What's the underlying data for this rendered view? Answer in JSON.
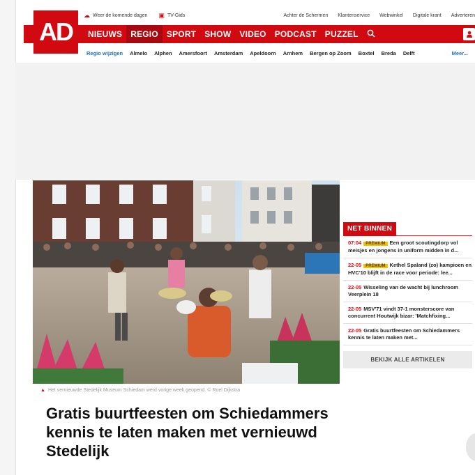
{
  "topbar": {
    "weather": "Weer de komende dagen",
    "tv": "TV-Gids",
    "links": [
      "Achter de Schermen",
      "Klantenservice",
      "Webwinkel",
      "Digitale krant",
      "Adverteren"
    ]
  },
  "logo": "AD",
  "nav": {
    "items": [
      "NIEUWS",
      "REGIO",
      "SPORT",
      "SHOW",
      "VIDEO",
      "PODCAST",
      "PUZZEL"
    ],
    "active": "REGIO"
  },
  "regio": {
    "change": "Regio wijzigen",
    "places": [
      "Almelo",
      "Alphen",
      "Amersfoort",
      "Amsterdam",
      "Apeldoorn",
      "Arnhem",
      "Bergen op Zoom",
      "Boxtel",
      "Breda",
      "Delft"
    ],
    "more": "Meer..."
  },
  "article": {
    "caption": "Het vernieuwde Stedelijk Museum Schiedam werd vorige week geopend. © Roel Dijkstra",
    "headline": "Gratis buurtfeesten om Schiedammers kennis te laten maken met vernieuwd Stedelijk"
  },
  "net_binnen": {
    "label": "NET BINNEN",
    "items": [
      {
        "time": "07:04",
        "premium": "PREMIUM",
        "text": "Een groot scoutingdorp vol meisjes en jongens in uniform midden in d..."
      },
      {
        "time": "22-05",
        "premium": "PREMIUM",
        "text": "Kethel Spaland (zo) kampioen en HVC'10 blijft in de race voor periode: lee..."
      },
      {
        "time": "22-05",
        "premium": "",
        "text": "Wisseling van de wacht bij lunchroom Veerplein 18"
      },
      {
        "time": "22-05",
        "premium": "",
        "text": "MSV'71 vindt 37-1 monsterscore van concurrent Houtwijk bizar: 'Matchfixing..."
      },
      {
        "time": "22-05",
        "premium": "",
        "text": "Gratis buurtfeesten om Schiedammers kennis te laten maken met..."
      }
    ],
    "button": "BEKIJK ALLE ARTIKELEN"
  },
  "colors": {
    "brand": "#d10a11",
    "premium": "#f2c200",
    "link": "#1b6fc0"
  }
}
